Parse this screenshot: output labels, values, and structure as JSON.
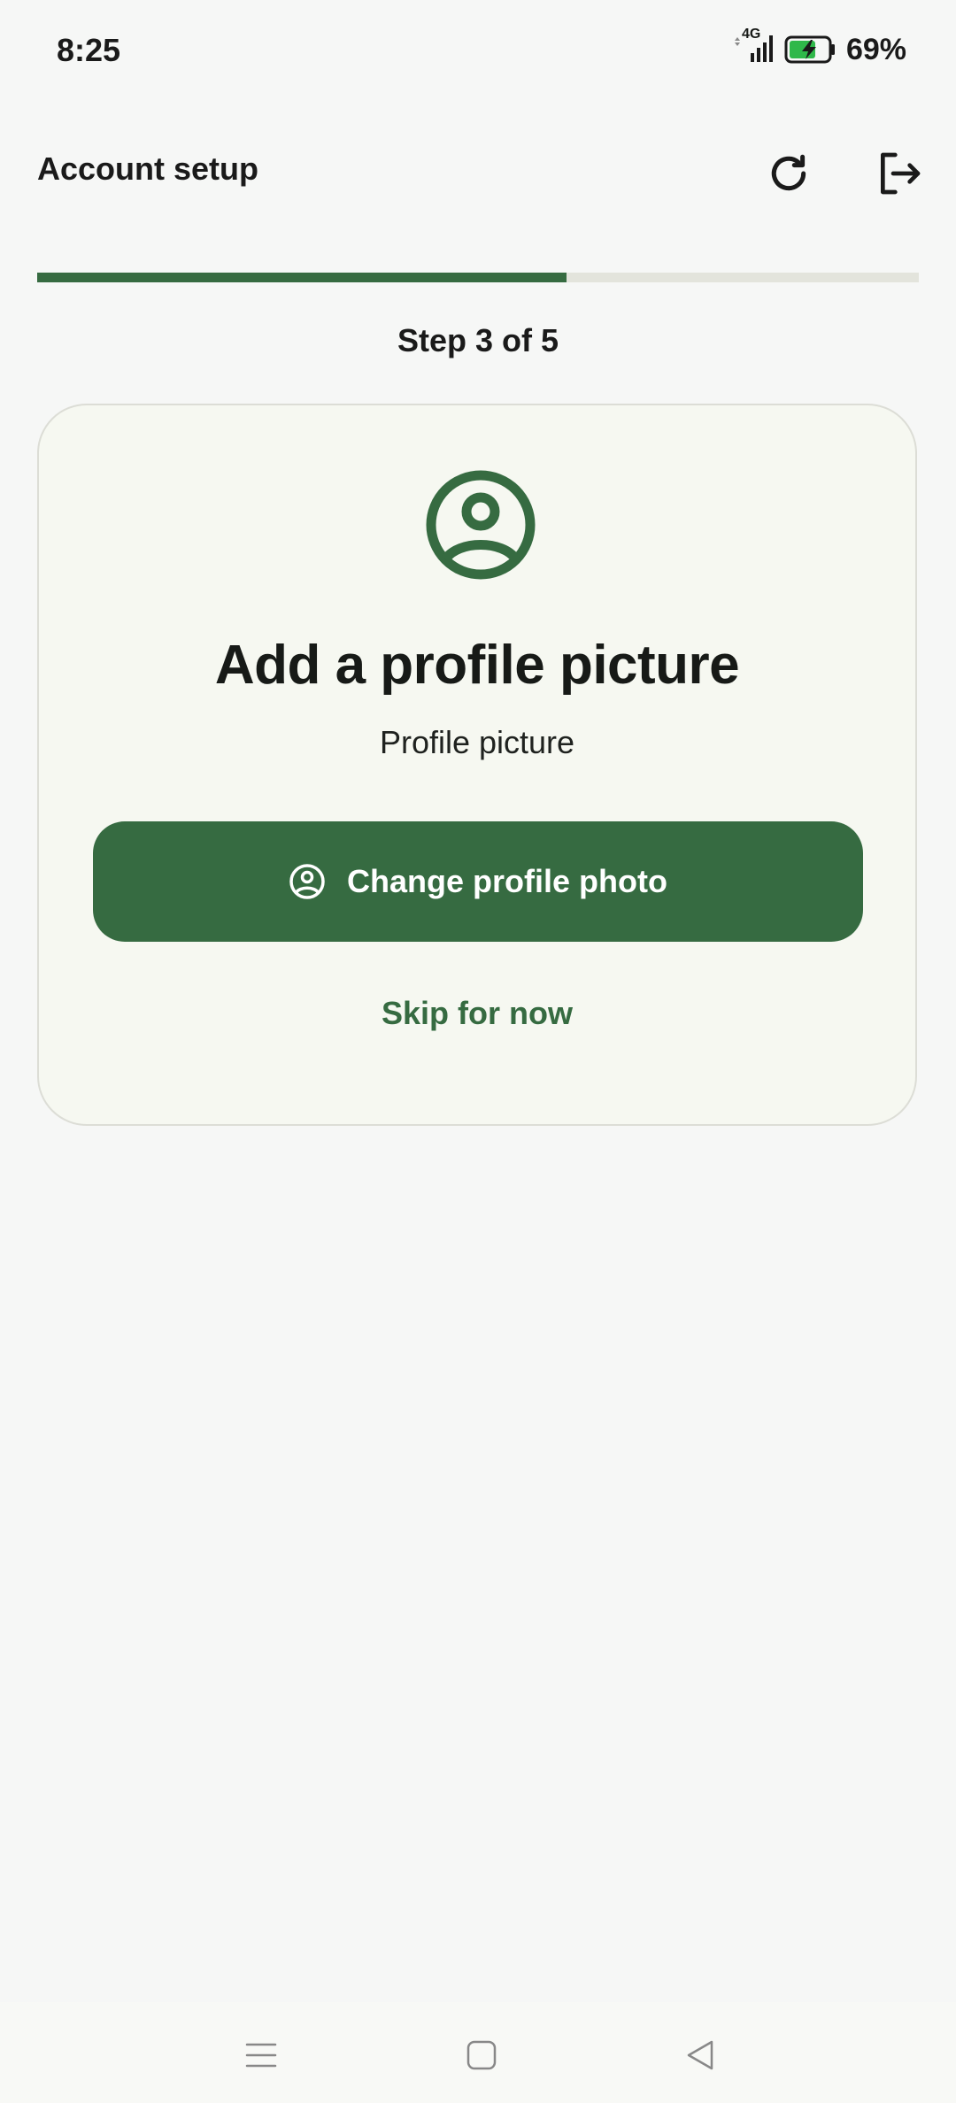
{
  "status_bar": {
    "time": "8:25",
    "network": "4G",
    "battery_percent": "69%",
    "battery_level": 0.69
  },
  "header": {
    "title": "Account setup",
    "refresh_icon": "refresh-icon",
    "logout_icon": "logout-icon"
  },
  "progress": {
    "current_step": 3,
    "total_steps": 5,
    "fraction": 0.6,
    "label": "Step 3 of 5"
  },
  "card": {
    "icon": "user-circle-icon",
    "title": "Add a profile picture",
    "subtitle": "Profile picture",
    "primary_button": {
      "icon": "user-circle-icon",
      "label": "Change profile photo"
    },
    "skip_label": "Skip for now"
  },
  "navigation_bar": {
    "menu_icon": "menu-icon",
    "home_icon": "home-icon",
    "back_icon": "back-icon"
  },
  "colors": {
    "accent": "#366b41",
    "background": "#f6f7f6",
    "card_background": "#f6f8f1",
    "progress_track": "#e3e4dc",
    "battery_fill": "#2fb84a"
  }
}
